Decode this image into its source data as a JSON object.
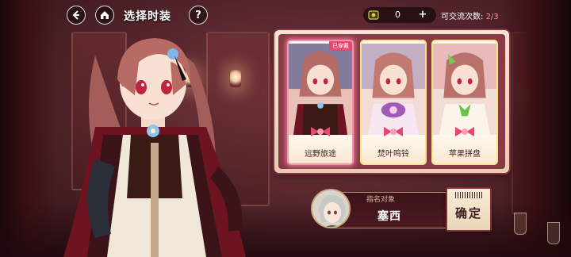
{
  "topbar": {
    "title": "选择时装",
    "back_icon": "back-arrow-icon",
    "home_icon": "home-icon",
    "help_label": "?",
    "currency_value": "0",
    "currency_plus": "+",
    "exchange_label": "可交流次数:",
    "exchange_count": "2/3"
  },
  "costumes": [
    {
      "label": "远野旅途",
      "equipped_tag": "已穿戴",
      "selected": true
    },
    {
      "label": "焚叶鸣铃",
      "selected": false
    },
    {
      "label": "苹果拼盘",
      "selected": false
    }
  ],
  "nominate": {
    "label": "指名对象",
    "name": "塞西",
    "confirm_label": "确定"
  },
  "colors": {
    "accent_pink": "#ff8aa8",
    "panel_border": "#8b2f3a",
    "equipped_tag": "#e8466c"
  }
}
